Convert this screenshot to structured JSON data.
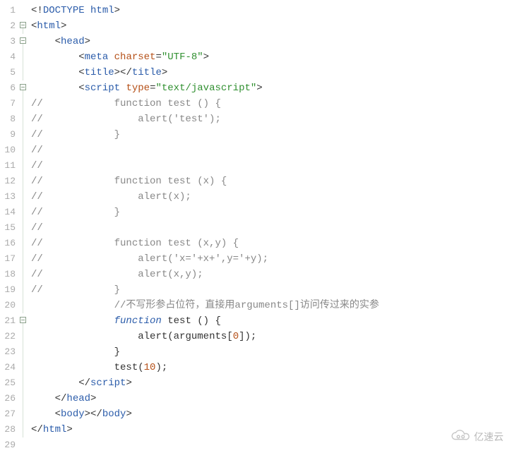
{
  "watermark": {
    "text": "亿速云"
  },
  "lines": [
    {
      "n": "1",
      "fold": "",
      "tokens": [
        [
          "pun",
          "<!"
        ],
        [
          "tag",
          "DOCTYPE html"
        ],
        [
          "pun",
          ">"
        ]
      ]
    },
    {
      "n": "2",
      "fold": "box",
      "tokens": [
        [
          "pun",
          "<"
        ],
        [
          "tag",
          "html"
        ],
        [
          "pun",
          ">"
        ]
      ]
    },
    {
      "n": "3",
      "fold": "box",
      "tokens": [
        [
          "pun",
          "    <"
        ],
        [
          "tag",
          "head"
        ],
        [
          "pun",
          ">"
        ]
      ]
    },
    {
      "n": "4",
      "fold": "line",
      "tokens": [
        [
          "pun",
          "        <"
        ],
        [
          "tag",
          "meta"
        ],
        [
          "pun",
          " "
        ],
        [
          "attr",
          "charset"
        ],
        [
          "pun",
          "="
        ],
        [
          "str",
          "\"UTF-8\""
        ],
        [
          "pun",
          ">"
        ]
      ]
    },
    {
      "n": "5",
      "fold": "line",
      "tokens": [
        [
          "pun",
          "        <"
        ],
        [
          "tag",
          "title"
        ],
        [
          "pun",
          "></"
        ],
        [
          "tag",
          "title"
        ],
        [
          "pun",
          ">"
        ]
      ]
    },
    {
      "n": "6",
      "fold": "box",
      "tokens": [
        [
          "pun",
          "        <"
        ],
        [
          "tag",
          "script"
        ],
        [
          "pun",
          " "
        ],
        [
          "attr",
          "type"
        ],
        [
          "pun",
          "="
        ],
        [
          "str",
          "\"text/javascript\""
        ],
        [
          "pun",
          ">"
        ]
      ]
    },
    {
      "n": "7",
      "fold": "line",
      "tokens": [
        [
          "cmt",
          "//            function test () {"
        ]
      ]
    },
    {
      "n": "8",
      "fold": "line",
      "tokens": [
        [
          "cmt",
          "//                alert('test');"
        ]
      ]
    },
    {
      "n": "9",
      "fold": "line",
      "tokens": [
        [
          "cmt",
          "//            }"
        ]
      ]
    },
    {
      "n": "10",
      "fold": "line",
      "tokens": [
        [
          "cmt",
          "//"
        ]
      ]
    },
    {
      "n": "11",
      "fold": "line",
      "tokens": [
        [
          "cmt",
          "//"
        ]
      ]
    },
    {
      "n": "12",
      "fold": "line",
      "tokens": [
        [
          "cmt",
          "//            function test (x) {"
        ]
      ]
    },
    {
      "n": "13",
      "fold": "line",
      "tokens": [
        [
          "cmt",
          "//                alert(x);"
        ]
      ]
    },
    {
      "n": "14",
      "fold": "line",
      "tokens": [
        [
          "cmt",
          "//            }"
        ]
      ]
    },
    {
      "n": "15",
      "fold": "line",
      "tokens": [
        [
          "cmt",
          "//"
        ]
      ]
    },
    {
      "n": "16",
      "fold": "line",
      "tokens": [
        [
          "cmt",
          "//            function test (x,y) {"
        ]
      ]
    },
    {
      "n": "17",
      "fold": "line",
      "tokens": [
        [
          "cmt",
          "//                alert('x='+x+',y='+y);"
        ]
      ]
    },
    {
      "n": "18",
      "fold": "line",
      "tokens": [
        [
          "cmt",
          "//                alert(x,y);"
        ]
      ]
    },
    {
      "n": "19",
      "fold": "line",
      "tokens": [
        [
          "cmt",
          "//            }"
        ]
      ]
    },
    {
      "n": "20",
      "fold": "line",
      "tokens": [
        [
          "cn",
          "              "
        ],
        [
          "cn-cmt",
          "//不写形参占位符，直接用arguments[]访问传过来的实参"
        ]
      ]
    },
    {
      "n": "21",
      "fold": "box",
      "tokens": [
        [
          "pun",
          "              "
        ],
        [
          "kw",
          "function"
        ],
        [
          "pun",
          " "
        ],
        [
          "fn",
          "test"
        ],
        [
          "pun",
          " () {"
        ]
      ]
    },
    {
      "n": "22",
      "fold": "line",
      "tokens": [
        [
          "pun",
          "                  "
        ],
        [
          "fn",
          "alert"
        ],
        [
          "pun",
          "("
        ],
        [
          "fn",
          "arguments"
        ],
        [
          "pun",
          "["
        ],
        [
          "num",
          "0"
        ],
        [
          "pun",
          "]);"
        ]
      ]
    },
    {
      "n": "23",
      "fold": "line",
      "tokens": [
        [
          "pun",
          "              }"
        ]
      ]
    },
    {
      "n": "24",
      "fold": "line",
      "tokens": [
        [
          "pun",
          "              "
        ],
        [
          "fn",
          "test"
        ],
        [
          "pun",
          "("
        ],
        [
          "num",
          "10"
        ],
        [
          "pun",
          ");"
        ]
      ]
    },
    {
      "n": "25",
      "fold": "line",
      "tokens": [
        [
          "pun",
          "        </"
        ],
        [
          "tag",
          "script"
        ],
        [
          "pun",
          ">"
        ]
      ]
    },
    {
      "n": "26",
      "fold": "line",
      "tokens": [
        [
          "pun",
          "    </"
        ],
        [
          "tag",
          "head"
        ],
        [
          "pun",
          ">"
        ]
      ]
    },
    {
      "n": "27",
      "fold": "line",
      "tokens": [
        [
          "pun",
          "    <"
        ],
        [
          "tag",
          "body"
        ],
        [
          "pun",
          "></"
        ],
        [
          "tag",
          "body"
        ],
        [
          "pun",
          ">"
        ]
      ]
    },
    {
      "n": "28",
      "fold": "line",
      "tokens": [
        [
          "pun",
          "</"
        ],
        [
          "tag",
          "html"
        ],
        [
          "pun",
          ">"
        ]
      ]
    },
    {
      "n": "29",
      "fold": "",
      "tokens": [
        [
          "pun",
          ""
        ]
      ]
    }
  ]
}
